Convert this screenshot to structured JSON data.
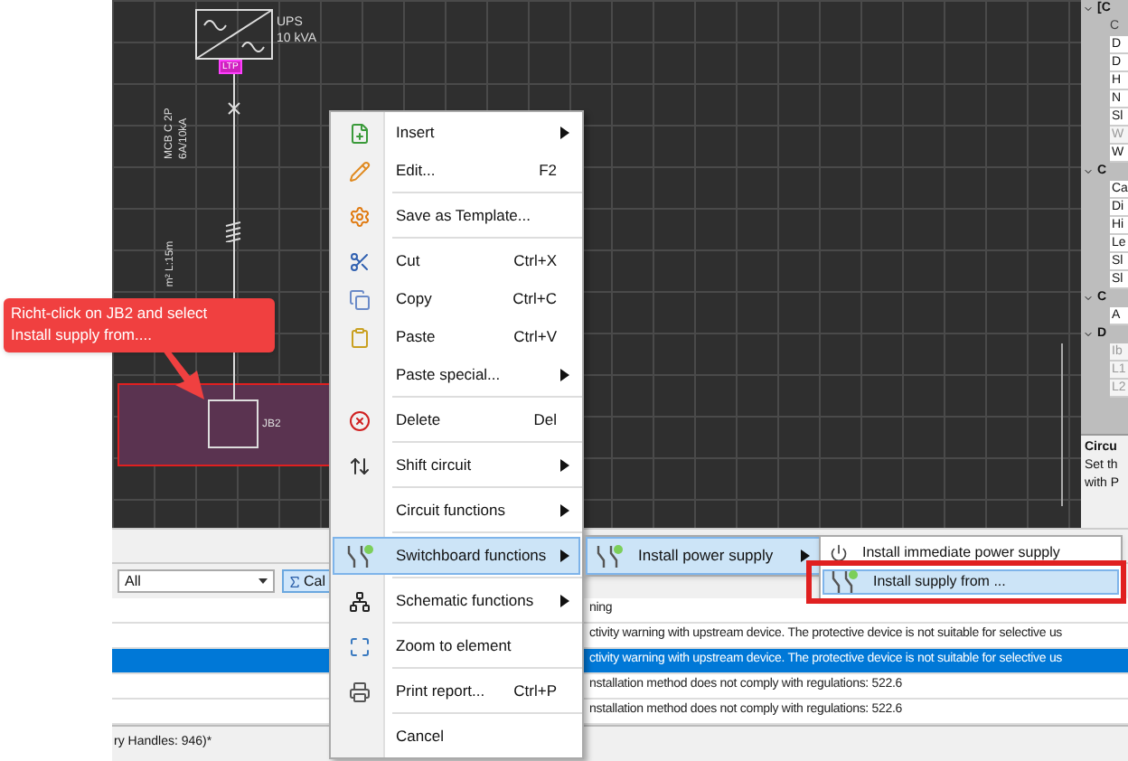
{
  "diagram": {
    "source": {
      "name": "UPS",
      "rating": "10 kVA",
      "tag": "LTP"
    },
    "breaker": {
      "line_1": "MCB C 2P",
      "line_2": "6A/10kA"
    },
    "cable": {
      "label": "m² L:15m"
    },
    "board": {
      "label": "JB2",
      "selected": true
    }
  },
  "callout": {
    "text": "Richt-click on JB2 and select Install supply from...."
  },
  "context_menu": [
    {
      "kind": "item",
      "label": "Insert",
      "has_submenu": true,
      "selected": false
    },
    {
      "kind": "item",
      "label": "Edit...",
      "shortcut": "F2",
      "has_submenu": false,
      "selected": false
    },
    {
      "kind": "separator"
    },
    {
      "kind": "item",
      "label": "Save as Template...",
      "has_submenu": false,
      "selected": false
    },
    {
      "kind": "separator"
    },
    {
      "kind": "item",
      "label": "Cut",
      "shortcut": "Ctrl+X",
      "has_submenu": false,
      "selected": false
    },
    {
      "kind": "item",
      "label": "Copy",
      "shortcut": "Ctrl+C",
      "has_submenu": false,
      "selected": false
    },
    {
      "kind": "item",
      "label": "Paste",
      "shortcut": "Ctrl+V",
      "has_submenu": false,
      "selected": false
    },
    {
      "kind": "item",
      "label": "Paste special...",
      "has_submenu": true,
      "selected": false
    },
    {
      "kind": "separator"
    },
    {
      "kind": "item",
      "label": "Delete",
      "shortcut": "Del",
      "has_submenu": false,
      "selected": false
    },
    {
      "kind": "separator"
    },
    {
      "kind": "item",
      "label": "Shift circuit",
      "has_submenu": true,
      "selected": false
    },
    {
      "kind": "separator"
    },
    {
      "kind": "item",
      "label": "Circuit functions",
      "has_submenu": true,
      "selected": false
    },
    {
      "kind": "separator"
    },
    {
      "kind": "item",
      "label": "Switchboard functions",
      "has_submenu": true,
      "selected": true
    },
    {
      "kind": "separator"
    },
    {
      "kind": "item",
      "label": "Schematic functions",
      "has_submenu": true,
      "selected": false
    },
    {
      "kind": "separator"
    },
    {
      "kind": "item",
      "label": "Zoom to element",
      "has_submenu": false,
      "selected": false
    },
    {
      "kind": "separator"
    },
    {
      "kind": "item",
      "label": "Print report...",
      "shortcut": "Ctrl+P",
      "has_submenu": false,
      "selected": false
    },
    {
      "kind": "separator"
    },
    {
      "kind": "item",
      "label": "Cancel",
      "has_submenu": false,
      "selected": false
    }
  ],
  "submenu": [
    {
      "label": "Install power supply",
      "has_submenu": true,
      "selected": true
    }
  ],
  "submenu_2": [
    {
      "label": "Install immediate power supply",
      "selected": false,
      "highlighted": false
    },
    {
      "label": "Install supply from ...",
      "selected": true,
      "highlighted": true
    }
  ],
  "properties_panel": {
    "groups": [
      {
        "header": "[C",
        "expanded": true,
        "caption": "C",
        "items": [
          {
            "label": "D",
            "disabled": false
          },
          {
            "label": "D",
            "disabled": false
          },
          {
            "label": "H",
            "disabled": false
          },
          {
            "label": "N",
            "disabled": false
          },
          {
            "label": "Sl",
            "disabled": false
          },
          {
            "label": "W",
            "disabled": true
          },
          {
            "label": "W",
            "disabled": false
          }
        ]
      },
      {
        "header": "C",
        "expanded": true,
        "items": [
          {
            "label": "Ca",
            "disabled": false
          },
          {
            "label": "Di",
            "disabled": false
          },
          {
            "label": "Hi",
            "disabled": false
          },
          {
            "label": "Le",
            "disabled": false
          },
          {
            "label": "Sl",
            "disabled": false
          },
          {
            "label": "Sl",
            "disabled": false
          }
        ]
      },
      {
        "header": "C",
        "expanded": true,
        "items": [
          {
            "label": "A",
            "disabled": false
          }
        ]
      },
      {
        "header": "D",
        "expanded": true,
        "items": [
          {
            "label": "Ib",
            "disabled": true
          },
          {
            "label": "L1",
            "disabled": true
          },
          {
            "label": "L2",
            "disabled": true
          }
        ]
      }
    ],
    "description": {
      "title": "Circu",
      "lines": [
        "Set th",
        "with P"
      ]
    }
  },
  "filter_bar": {
    "filter": "All",
    "button": "Cal"
  },
  "messages": [
    {
      "text": "ning",
      "selected": false
    },
    {
      "text": "ctivity warning with upstream device. The protective device is not suitable for selective us",
      "selected": false
    },
    {
      "text": "ctivity warning with upstream device. The protective device is not suitable for selective us",
      "selected": true
    },
    {
      "text": "nstallation method does not comply with regulations: 522.6",
      "selected": false
    },
    {
      "text": "nstallation method does not comply with regulations: 522.6",
      "selected": false
    }
  ],
  "status_bar": "ry Handles: 946)*"
}
